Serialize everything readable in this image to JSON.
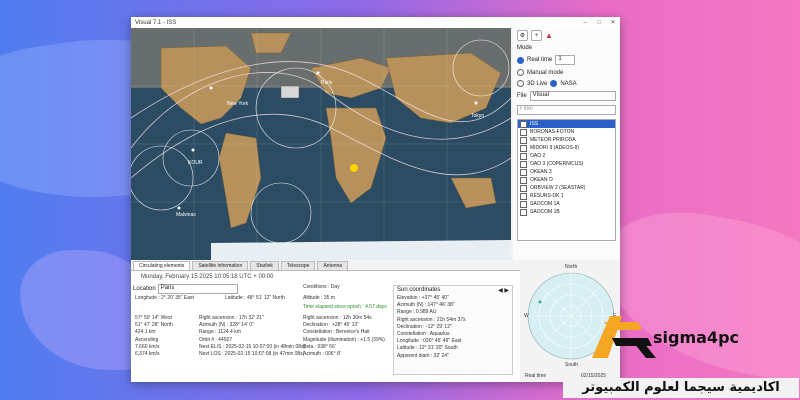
{
  "window": {
    "title": "Visual 7.1 - ISS"
  },
  "map": {
    "city_labels": [
      "New York",
      "Paris",
      "Tokyo",
      "KOUR",
      "Malvinas",
      "Cancun"
    ],
    "ocean_color": "#2a4a60",
    "land_color": "#b8905a"
  },
  "controls": {
    "mode_label": "Mode",
    "realtime_label": "Real time",
    "realtime_value": "1",
    "manual_label": "Manual mode",
    "source_3d": "3D Live",
    "source_nasa": "NASA",
    "file_label": "File",
    "file_value": "Visual",
    "filter_placeholder": "Filter",
    "satellites": [
      "ISS",
      "BORONAS-FOTON",
      "METEOR PRIRODA",
      "MIDORI II (ADEOS-II)",
      "OAO 2",
      "OAO 3 (COPERNICUS)",
      "OKEAN 3",
      "OKEAN O",
      "ORBVIEW 2 (SEASTAR)",
      "RESURS-DK 1",
      "SAOCOM 1A",
      "SAOCOM 1B"
    ]
  },
  "tabs": [
    "Circulating elements",
    "Satellite information",
    "Starlink",
    "Telescope",
    "Antenna"
  ],
  "details": {
    "date": "Monday, February 15 2025  10:05:18  UTC + 00:00",
    "location_label": "Location",
    "location_value": "Paris",
    "conditions": "Conditions : Day",
    "longitude": "Longitude : 2° 20' 35\" East",
    "latitude": "Latitude : 48° 51' 12\" North",
    "altitude": "Altitude : 35 m",
    "elapsed": "Time elapsed since epoch : 4.57 days",
    "left_col": [
      "57° 50' 14\" West",
      "51° 47' 28\" North",
      "424.1 km",
      "Ascending",
      "7.660 km/s",
      "6,374 km/s"
    ],
    "mid_col": [
      "Right ascension : 17h 32' 21\"",
      "Azimuth (N) : 328° 14' 0\"",
      "Range : 1124.4 km",
      "Orbit # : 44927",
      "Next EL/S : 2025-02-15 10:07:00 (in 48min 08s)",
      "Next LOS : 2025-02-15 10:07:08 (in 47min 08s)"
    ],
    "right_col": [
      "Right ascension : 12h 36m 54s",
      "Declination : +28° 45' 10\"",
      "Constellation : Berenice's Hair",
      "Magnitude (illumination) : +1.5 (39%)",
      "Beta : 038° 56'",
      "Azimuth : 006° 8'"
    ]
  },
  "sun": {
    "header": "Sun coordinates",
    "rows": [
      "Elevation : +37° 45' 40\"",
      "Azimuth (N) : 147° 46' 38\"",
      "Range : 0.989 AU",
      "Right ascension : 21h 54m 37s",
      "Declination : -12° 29' 12\"",
      "Constellation : Aquarius",
      "Longitude : 030° 45' 49\" East",
      "Latitude : 12° 31' 20\" South",
      "Apparent diam : 32' 24\""
    ]
  },
  "radar": {
    "north": "North",
    "south": "South",
    "east": "E",
    "west": "W",
    "realtime": "Real time",
    "timestamp": "02/15/2025"
  },
  "branding": {
    "logo_letters": "S",
    "name": "sigma4pc",
    "arabic": "اكاديمية سيجما لعلوم الكمبيوتر"
  }
}
